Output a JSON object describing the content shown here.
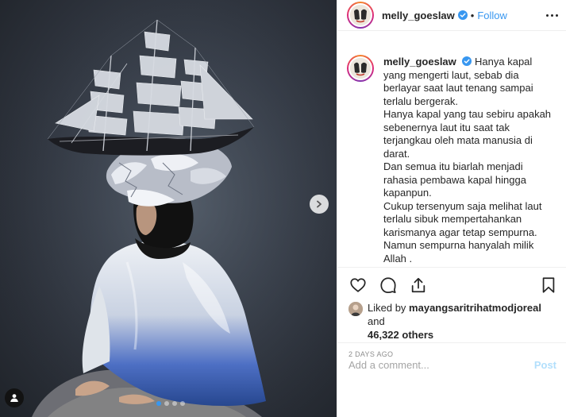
{
  "post": {
    "username": "melly_goeslaw",
    "verified": true,
    "separator": "•",
    "follow_label": "Follow",
    "caption": "Hanya kapal yang mengerti laut, sebab dia berlayar saat laut tenang sampai terlalu bergerak.\nHanya kapal yang tau sebiru apakah sebenernya laut itu saat tak terjangkau oleh mata manusia di darat.\nDan semua itu biarlah menjadi rahasia pembawa kapal hingga kapanpun.\nCukup tersenyum saja melihat laut terlalu sibuk mempertahankan karismanya agar tetap sempurna.\nNamun sempurna hanyalah milik Allah .\nDan kapal harus tetap berlayar hingga membawa penumpangnya sampai ke tujuan.",
    "likes": {
      "prefix": "Liked by",
      "liker": "mayangsaritrihatmodjoreal",
      "conjunction": "and",
      "others": "46,322 others"
    },
    "timestamp": "2 DAYS AGO",
    "comment_placeholder": "Add a comment...",
    "post_button": "Post"
  },
  "carousel": {
    "slide_count": 4,
    "active_index": 0
  },
  "icons": {
    "like": "heart-icon",
    "comment": "comment-icon",
    "share": "share-icon",
    "save": "bookmark-icon",
    "more": "more-options-icon",
    "next": "chevron-right-icon",
    "tagged": "user-tag-icon"
  },
  "colors": {
    "link_blue": "#3897f0",
    "post_disabled": "#b2dffc",
    "muted": "#8e8e8e"
  }
}
